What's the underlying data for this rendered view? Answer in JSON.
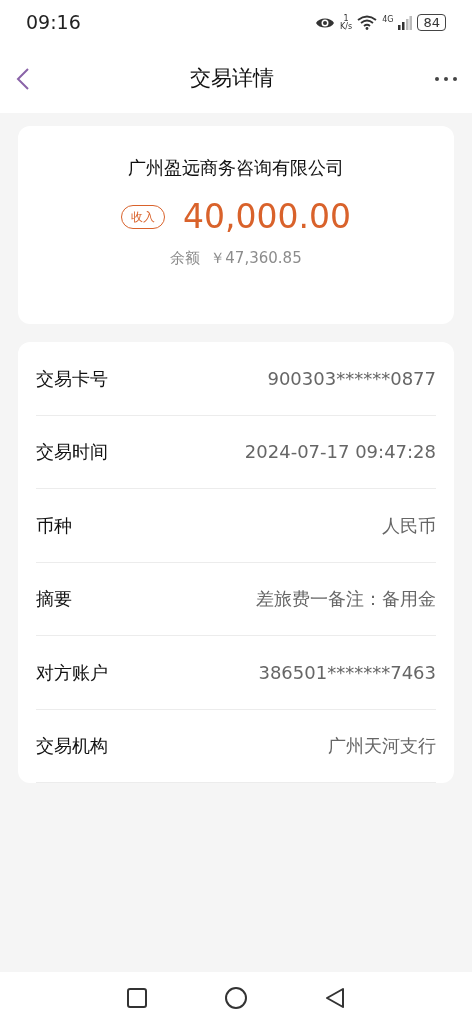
{
  "status_bar": {
    "time": "09:16",
    "speed_value": "1",
    "speed_unit": "K/s",
    "network": "4G",
    "battery": "84"
  },
  "header": {
    "title": "交易详情"
  },
  "summary": {
    "payee": "广州盈远商务咨询有限公司",
    "type_badge": "收入",
    "amount": "40,000.00",
    "balance_label": "余额",
    "balance": "￥47,360.85"
  },
  "details": [
    {
      "label": "交易卡号",
      "value": "900303******0877"
    },
    {
      "label": "交易时间",
      "value": "2024-07-17 09:47:28"
    },
    {
      "label": "币种",
      "value": "人民币"
    },
    {
      "label": "摘要",
      "value": "差旅费一备注：备用金"
    },
    {
      "label": "对方账户",
      "value": "386501*******7463"
    },
    {
      "label": "交易机构",
      "value": "广州天河支行"
    }
  ]
}
